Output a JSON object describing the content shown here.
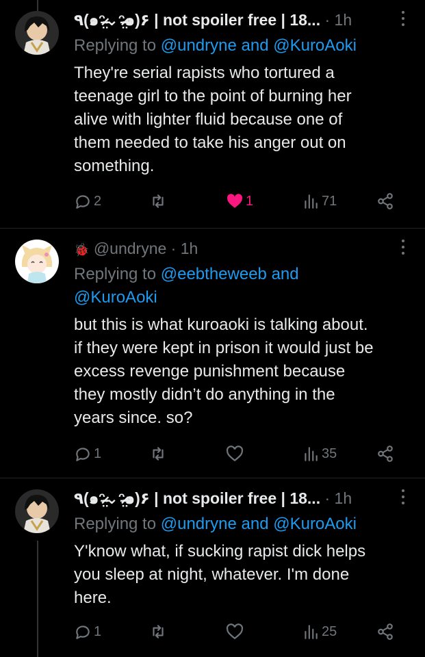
{
  "tweets": [
    {
      "author": "٩(๑ᵔ̴̶̷̤⌄ᵔ̴̶̷̤๑)۶ | not spoiler free | 18...",
      "time": "· 1h",
      "replying_prefix": "Replying to",
      "replying_to": "@undryne and @KuroAoki",
      "text": [
        "They're serial rapists who tortured a",
        "teenage girl to the point of burning her",
        "alive with lighter fluid because one of",
        "them needed to take his anger out on",
        "something."
      ],
      "replies": "2",
      "retweets": "",
      "likes": "1",
      "liked": true,
      "views": "71"
    },
    {
      "author_emoji": "🐞",
      "author": "@undryne",
      "time": "· 1h",
      "replying_prefix": "Replying to",
      "replying_to": "@eebtheweeb and",
      "replying_to_2": "@KuroAoki",
      "text": [
        "but this is what kuroaoki is talking about.",
        "if they were kept in prison it would just be",
        "excess revenge punishment because",
        "they mostly didn’t do anything in the",
        "years since. so?"
      ],
      "replies": "1",
      "retweets": "",
      "likes": "",
      "liked": false,
      "views": "35"
    },
    {
      "author": "٩(๑ᵔ̴̶̷̤⌄ᵔ̴̶̷̤๑)۶ | not spoiler free | 18...",
      "time": "· 1h",
      "replying_prefix": "Replying to",
      "replying_to": "@undryne and @KuroAoki",
      "text": [
        "Y'know what, if sucking rapist dick helps",
        "you sleep at night, whatever. I'm done",
        "here."
      ],
      "replies": "1",
      "retweets": "",
      "likes": "",
      "liked": false,
      "views": "25"
    }
  ],
  "colors": {
    "background": "#000000",
    "text": "#e7e9ea",
    "muted": "#71767b",
    "link": "#1d9bf0",
    "like": "#f91880"
  },
  "icons": [
    "reply-icon",
    "retweet-icon",
    "like-icon",
    "views-icon",
    "share-icon",
    "more-icon"
  ]
}
